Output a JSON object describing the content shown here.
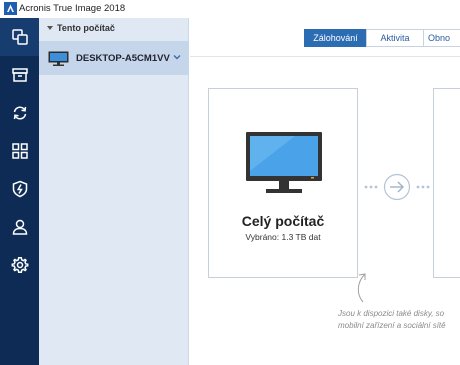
{
  "window": {
    "title": "Acronis True Image 2018"
  },
  "leftnav": {
    "items": [
      {
        "name": "backup",
        "icon": "copy-icon"
      },
      {
        "name": "archive",
        "icon": "archive-box-icon"
      },
      {
        "name": "sync",
        "icon": "sync-icon"
      },
      {
        "name": "tools",
        "icon": "grid-icon"
      },
      {
        "name": "protection",
        "icon": "shield-bolt-icon"
      },
      {
        "name": "account",
        "icon": "user-icon"
      },
      {
        "name": "settings",
        "icon": "gear-icon"
      }
    ]
  },
  "sidebar": {
    "header": "Tento počítač",
    "computer": "DESKTOP-A5CM1VV"
  },
  "tabs": [
    {
      "label": "Zálohování",
      "active": true
    },
    {
      "label": "Aktivita",
      "active": false
    },
    {
      "label": "Obno",
      "active": false
    }
  ],
  "source_card": {
    "title": "Celý počítač",
    "subtitle": "Vybráno: 1.3 TB dat"
  },
  "hint": {
    "line1": "Jsou k dispozici také disky, so",
    "line2": "mobilní zařízení a sociální sítě"
  },
  "colors": {
    "nav_bg": "#0d2b54",
    "sidebar_bg": "#dfe8f3",
    "selected_bg": "#c6d6ea",
    "accent": "#2c6cb3"
  }
}
